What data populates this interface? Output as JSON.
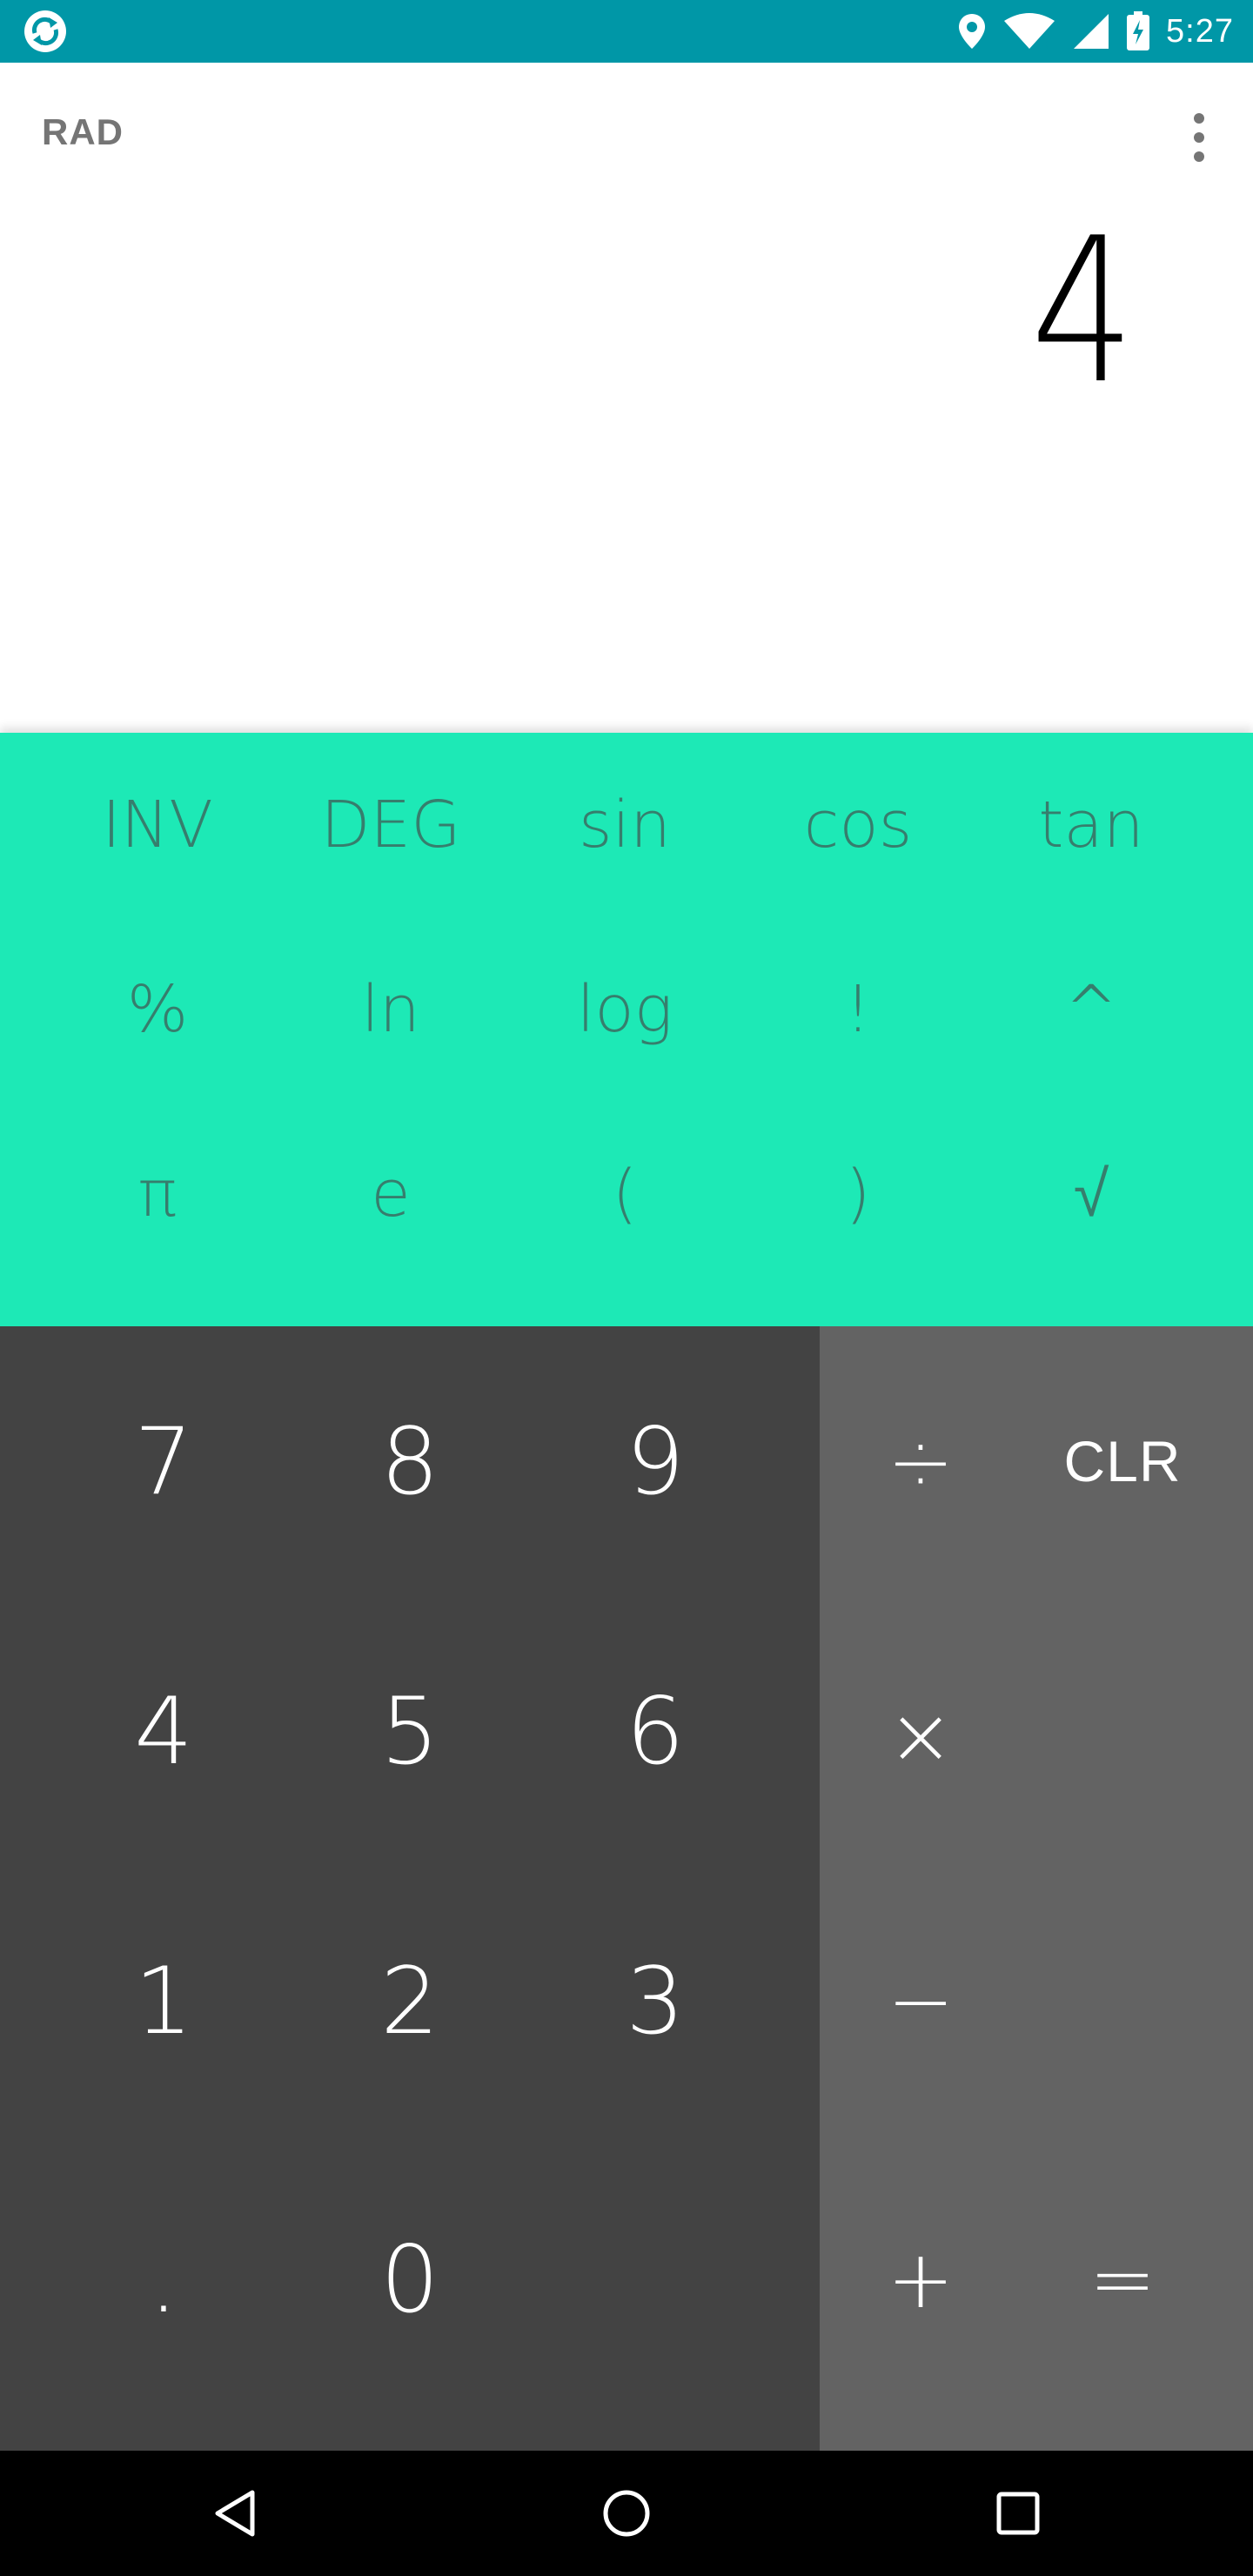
{
  "status_bar": {
    "time": "5:27",
    "icons": [
      "app-sync-icon",
      "location-icon",
      "wifi-icon",
      "signal-icon",
      "battery-charging-icon"
    ]
  },
  "display": {
    "angle_mode": "RAD",
    "result": "4",
    "overflow_icon": "more-vert-icon"
  },
  "advanced_pad": {
    "row1": [
      "INV",
      "DEG",
      "sin",
      "cos",
      "tan"
    ],
    "row2": [
      "%",
      "ln",
      "log",
      "!",
      "^"
    ],
    "row3": [
      "π",
      "e",
      "(",
      ")",
      "√"
    ]
  },
  "numeric_pad": {
    "row1": [
      "7",
      "8",
      "9"
    ],
    "row2": [
      "4",
      "5",
      "6"
    ],
    "row3": [
      "1",
      "2",
      "3"
    ],
    "row4": [
      ".",
      "0"
    ]
  },
  "operator_pad": {
    "divide": "÷",
    "clear": "CLR",
    "multiply": "×",
    "minus": "−",
    "plus": "+",
    "equals": "="
  },
  "nav_bar": {
    "icons": [
      "back-icon",
      "home-icon",
      "recents-icon"
    ]
  },
  "colors": {
    "status_bar": "#0097a7",
    "advanced_pad": "#1de9b6",
    "advanced_text": "#367e6d",
    "numeric_pad": "#434343",
    "operator_pad": "#636363"
  }
}
